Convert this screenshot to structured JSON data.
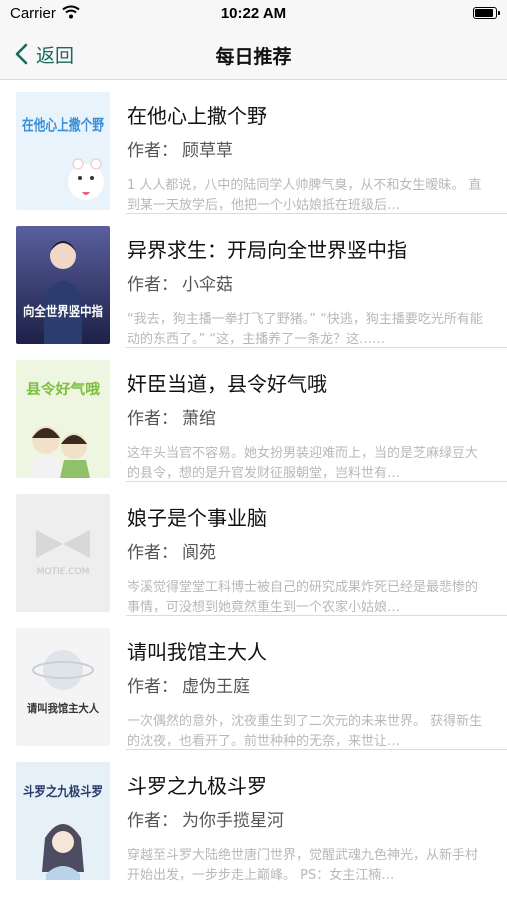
{
  "status_bar": {
    "carrier": "Carrier",
    "time": "10:22 AM",
    "battery_level": 0.95
  },
  "nav": {
    "back_label": "返回",
    "title": "每日推荐"
  },
  "author_label": "作者：",
  "books": [
    {
      "title": "在他心上撒个野",
      "author": "顾草草",
      "summary": "1 人人都说，八中的陆同学人帅脾气臭，从不和女生暧昧。 直到某一天放学后，他把一个小姑娘抵在班级后…",
      "cover_text": "在他心上撒个野"
    },
    {
      "title": "异界求生：开局向全世界竖中指",
      "author": "小伞菇",
      "summary": "“我去，狗主播一拳打飞了野猪。” “快逃，狗主播要吃光所有能动的东西了。” “这，主播养了一条龙？这……",
      "cover_text": "向全世界竖中指"
    },
    {
      "title": "奸臣当道，县令好气哦",
      "author": "萧绾",
      "summary": "这年头当官不容易。她女扮男装迎难而上，当的是芝麻绿豆大的县令，想的是升官发财征服朝堂，岂料世有…",
      "cover_text": "县令好气哦"
    },
    {
      "title": "娘子是个事业脑",
      "author": "阆苑",
      "summary": "岑溪觉得堂堂工科博士被自己的研究成果炸死已经是最悲惨的事情，可没想到她竟然重生到一个农家小姑娘…",
      "cover_text": "MOTIE.COM"
    },
    {
      "title": "请叫我馆主大人",
      "author": "虚伪王庭",
      "summary": "一次偶然的意外，沈夜重生到了二次元的未来世界。 获得新生的沈夜，也看开了。前世种种的无奈，来世让…",
      "cover_text": "请叫我馆主大人"
    },
    {
      "title": "斗罗之九极斗罗",
      "author": "为你手揽星河",
      "summary": "穿越至斗罗大陆绝世唐门世界，觉醒武魂九色神光，从新手村开始出发，一步步走上巅峰。 PS：女主江楠…",
      "cover_text": "斗罗之九极斗罗"
    }
  ]
}
